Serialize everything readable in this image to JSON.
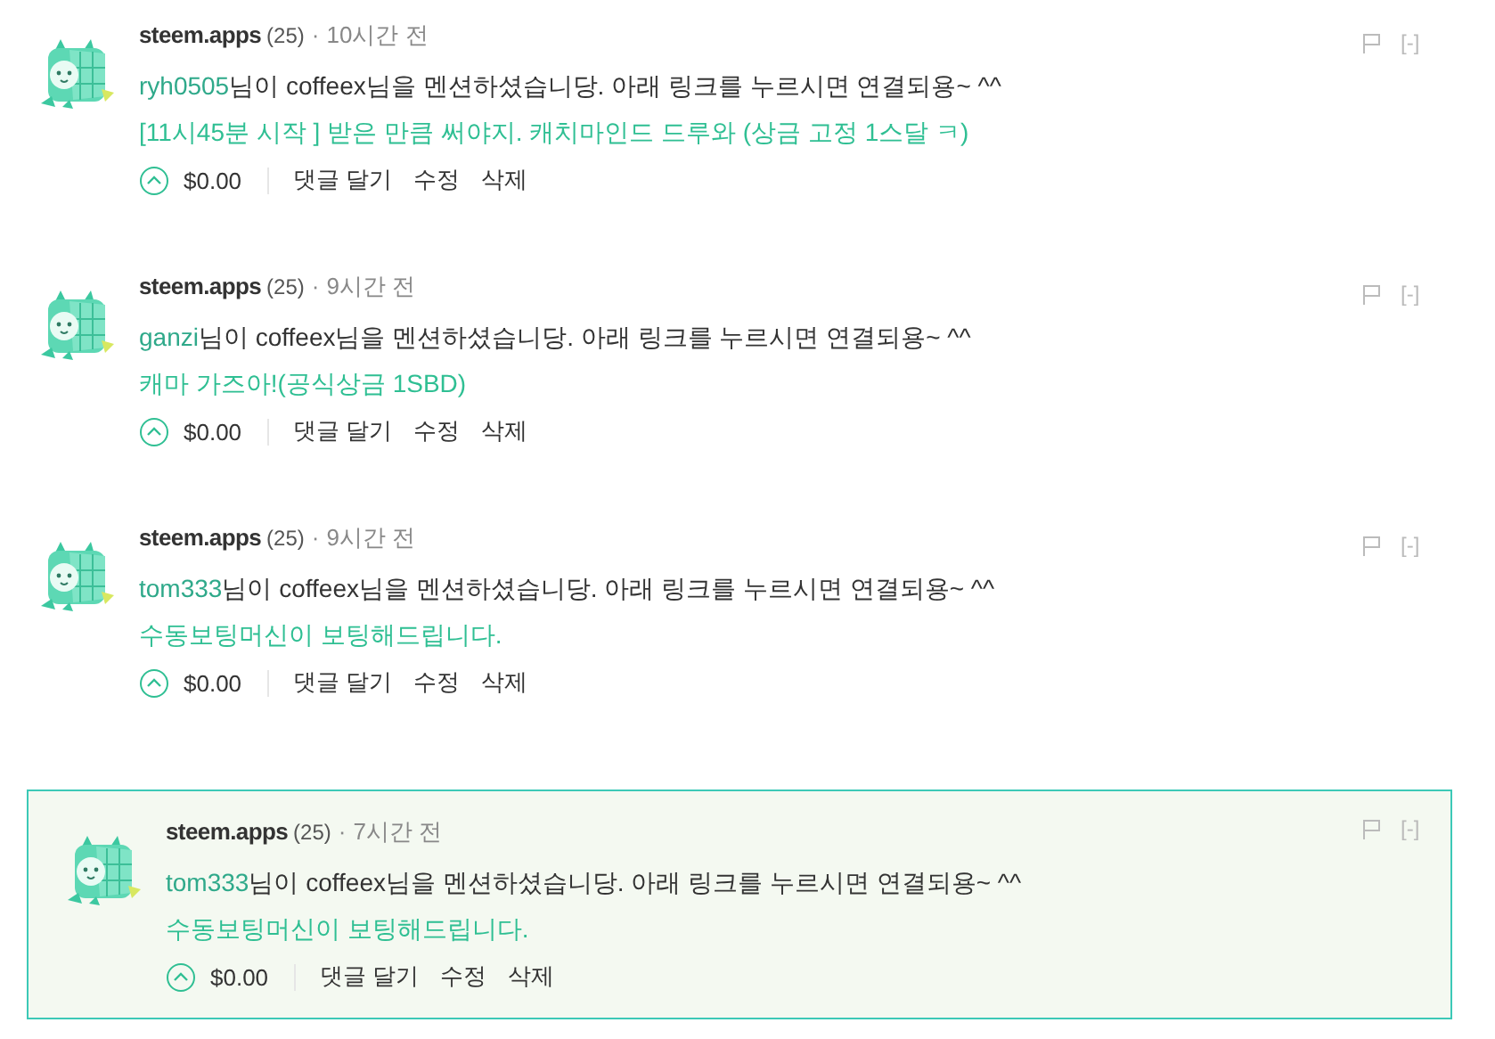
{
  "comments": [
    {
      "author": "steem.apps",
      "reputation": "(25)",
      "separator": "·",
      "time": "10시간 전",
      "mention_user": "ryh0505",
      "message": "님이 coffeex님을 멘션하셨습니당. 아래 링크를 누르시면 연결되용~ ^^",
      "link": "[11시45분 시작 ] 받은 만큼 써야지. 캐치마인드 드루와 (상금 고정 1스달 ㅋ)",
      "payout": "$0.00",
      "actions": [
        "댓글 달기",
        "수정",
        "삭제"
      ],
      "collapse": "[-]",
      "selected": false
    },
    {
      "author": "steem.apps",
      "reputation": "(25)",
      "separator": "·",
      "time": "9시간 전",
      "mention_user": "ganzi",
      "message": "님이 coffeex님을 멘션하셨습니당. 아래 링크를 누르시면 연결되용~ ^^",
      "link": "캐마 가즈아!(공식상금 1SBD)",
      "payout": "$0.00",
      "actions": [
        "댓글 달기",
        "수정",
        "삭제"
      ],
      "collapse": "[-]",
      "selected": false
    },
    {
      "author": "steem.apps",
      "reputation": "(25)",
      "separator": "·",
      "time": "9시간 전",
      "mention_user": "tom333",
      "message": "님이 coffeex님을 멘션하셨습니당. 아래 링크를 누르시면 연결되용~ ^^",
      "link": "수동보팅머신이 보팅해드립니다.",
      "payout": "$0.00",
      "actions": [
        "댓글 달기",
        "수정",
        "삭제"
      ],
      "collapse": "[-]",
      "selected": false
    },
    {
      "author": "steem.apps",
      "reputation": "(25)",
      "separator": "·",
      "time": "7시간 전",
      "mention_user": "tom333",
      "message": "님이 coffeex님을 멘션하셨습니당. 아래 링크를 누르시면 연결되용~ ^^",
      "link": "수동보팅머신이 보팅해드립니다.",
      "payout": "$0.00",
      "actions": [
        "댓글 달기",
        "수정",
        "삭제"
      ],
      "collapse": "[-]",
      "selected": true
    }
  ]
}
